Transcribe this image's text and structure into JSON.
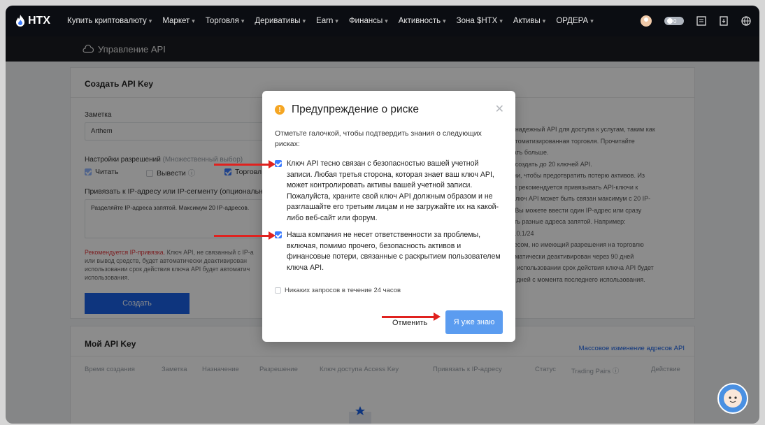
{
  "nav": {
    "logo_text": "HTX",
    "items": [
      {
        "label": "Купить криптовалюту",
        "caret": true
      },
      {
        "label": "Маркет",
        "caret": true
      },
      {
        "label": "Торговля",
        "caret": true
      },
      {
        "label": "Деривативы",
        "caret": true
      },
      {
        "label": "Earn",
        "caret": true
      },
      {
        "label": "Финансы",
        "caret": true
      },
      {
        "label": "Активность",
        "caret": true
      },
      {
        "label": "Зона $HTX",
        "caret": true
      },
      {
        "label": "Активы",
        "caret": true
      },
      {
        "label": "ОРДЕРА",
        "caret": true
      }
    ],
    "icons": [
      "avatar-icon",
      "wallet-toggle-icon",
      "orders-icon",
      "download-icon",
      "globe-icon"
    ]
  },
  "subheader": {
    "title": "Управление API"
  },
  "create_card": {
    "title": "Создать API Key",
    "note_label": "Заметка",
    "note_value": "Arthem",
    "permissions_label": "Настройки разрешений",
    "permissions_hint": "(Множественный выбор)",
    "perm_read": "Читать",
    "perm_withdraw": "Вывести",
    "perm_trade": "Торговл",
    "ip_label": "Привязать к IP-адресу или IP-сегменту (опционально)",
    "ip_placeholder": "Разделяйте IP-адреса запятой. Максимум 20 IP-адресов.",
    "rec_red": "Рекомендуется IP-привязка.",
    "rec_text": "Ключ API, не связанный с IP-а",
    "rec_line2": "или вывод средств, будет автоматически деактивирован",
    "rec_line3": "использовании срок действия ключа API будет автоматич",
    "rec_line4": "использования.",
    "create_button": "Создать"
  },
  "right_text": {
    "lines": [
      "ать наш надежный API для доступа к услугам, таким как",
      "ных и автоматизированная торговля. Прочитайте",
      "обы узнать больше.",
      "ь может создать до 20 ключей API.",
      "API-ключи, чтобы предотвратить потерю активов. Из",
      "пасности рекомендуется привязывать API-ключи к",
      "ресам. Ключ API может быть связан максимум с 20 IP-",
      "ентами. Вы можете ввести один IP-адрес или сразу",
      "разделить разные адреса запятой. Например:",
      ",192.168.0.1/24",
      "с IP-адресом, но имеющий разрешения на торговлю",
      "дет автоматически деактивирован через 90 дней",
      "улярном использовании срок действия ключа API будет",
      "ен на 90 дней с момента последнего использования."
    ]
  },
  "keys_card": {
    "title": "Мой API Key",
    "batch_link": "Массовое изменение адресов API",
    "columns": [
      "Время создания",
      "Заметка",
      "Назначение",
      "Разрешение",
      "Ключ доступа Access Key",
      "Привязать к IP-адресу",
      "Статус",
      "Trading Pairs ⓘ",
      "Действие"
    ]
  },
  "modal": {
    "title": "Предупреждение о риске",
    "intro": "Отметьте галочкой, чтобы подтвердить знания о следующих рисках:",
    "item1": "Ключ API тесно связан с безопасностью вашей учетной записи. Любая третья сторона, которая знает ваш ключ API, может контролировать активы вашей учетной записи. Пожалуйста, храните свой ключ API должным образом и не разглашайте его третьим лицам и не загружайте их на какой-либо веб-сайт или форум.",
    "item2": "Наша компания не несет ответственности за проблемы, включая, помимо прочего, безопасность активов и финансовые потери, связанные с раскрытием пользователем ключа API.",
    "no_requests": "Никаких запросов в течение 24 часов",
    "cancel": "Отменить",
    "confirm": "Я уже знаю"
  },
  "colors": {
    "accent": "#1a62e5",
    "confirm": "#5b9cf0",
    "warning": "#f5a623",
    "arrow": "#e0221f"
  }
}
